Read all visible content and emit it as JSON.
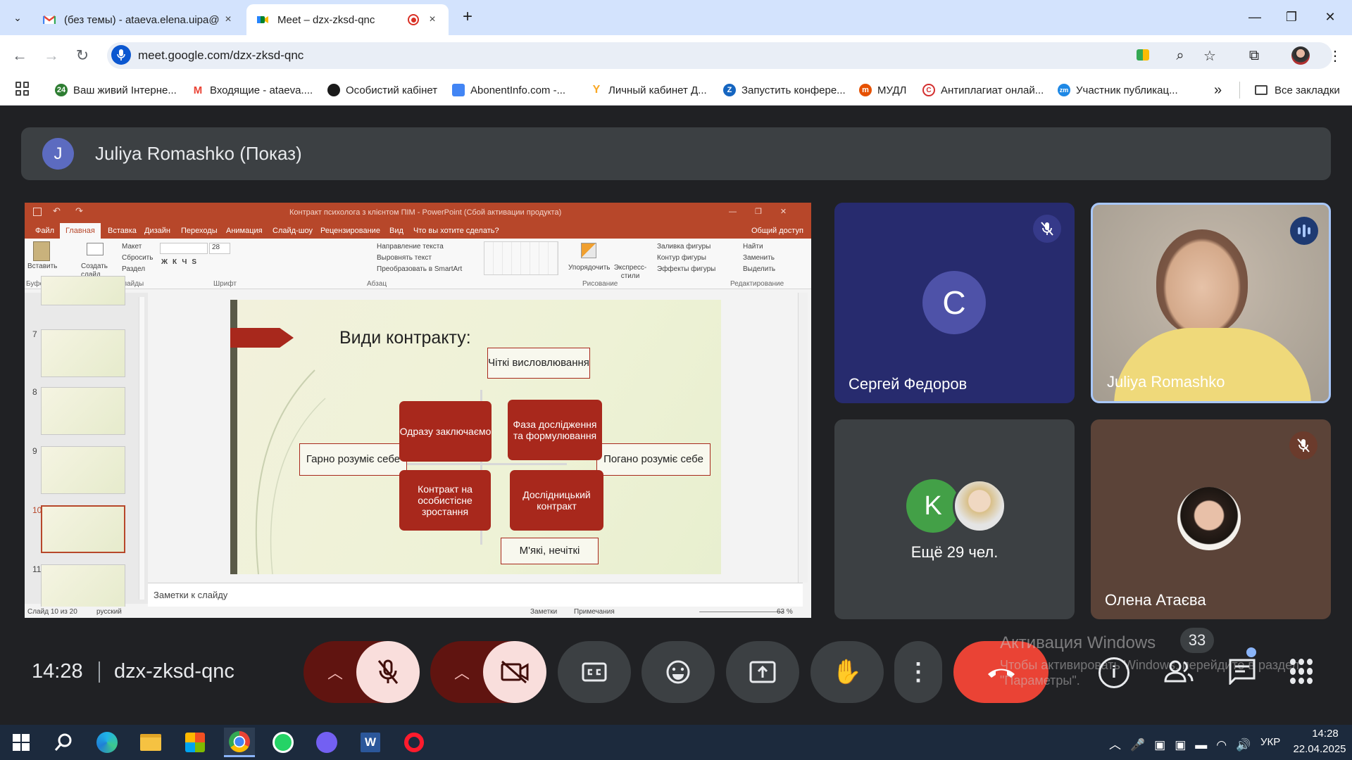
{
  "browser": {
    "tabs": [
      {
        "title": "(без темы) - ataeva.elena.uipa@",
        "close": "×"
      },
      {
        "title": "Meet – dzx-zksd-qnc",
        "close": "×"
      }
    ],
    "new_tab": "+",
    "url": "meet.google.com/dzx-zksd-qnc",
    "bookmarks": [
      {
        "label": "Ваш живий Інтерне...",
        "icon": "24",
        "color": "#2e7d32"
      },
      {
        "label": "Входящие - ataeva....",
        "icon": "M",
        "color": "#ea4335"
      },
      {
        "label": "Особистий кабінет",
        "icon": "",
        "color": "#1a1a1a"
      },
      {
        "label": "AbonentInfo.com -...",
        "icon": "",
        "color": "#4285f4"
      },
      {
        "label": "Личный кабинет Д...",
        "icon": "Y",
        "color": "#f9a825"
      },
      {
        "label": "Запустить конфере...",
        "icon": "Z",
        "color": "#1565c0"
      },
      {
        "label": "МУДЛ",
        "icon": "m",
        "color": "#e65100"
      },
      {
        "label": "Антиплагиат онлай...",
        "icon": "C",
        "color": "#d32f2f"
      },
      {
        "label": "Участник публикац...",
        "icon": "zm",
        "color": "#1e88e5"
      }
    ],
    "all_bookmarks": "Все закладки",
    "more": "»"
  },
  "meet": {
    "presenter_initial": "J",
    "presenter_label": "Juliya Romashko (Показ)",
    "participants": [
      {
        "name": "Сергей Федоров",
        "initial": "C",
        "muted": true
      },
      {
        "name": "Juliya Romashko",
        "speaking": true
      },
      {
        "more_label": "Ещё 29 чел.",
        "initial": "K"
      },
      {
        "name": "Олена Атаєва",
        "muted": true
      }
    ],
    "time": "14:28",
    "meeting_code": "dzx-zksd-qnc",
    "people_count": "33",
    "activation_title": "Активация Windows",
    "activation_body": "Чтобы активировать Windows, перейдите в раздел \"Параметры\"."
  },
  "ppt": {
    "title": "Контракт психолога з клієнтом ПІМ - PowerPoint (Сбой активации продукта)",
    "tabs": [
      "Файл",
      "Главная",
      "Вставка",
      "Дизайн",
      "Переходы",
      "Анимация",
      "Слайд-шоу",
      "Рецензирование",
      "Вид",
      "Что вы хотите сделать?"
    ],
    "share": "Общий доступ",
    "ribbon_groups": [
      "Буфер обмена",
      "Слайды",
      "Шрифт",
      "Абзац",
      "Рисование",
      "Редактирование"
    ],
    "ribbon_items": {
      "paste": "Вставить",
      "new_slide": "Создать слайд",
      "layout": "Макет",
      "reset": "Сбросить",
      "section": "Раздел",
      "font_size": "28",
      "text_direction": "Направление текста",
      "align_text": "Выровнять текст",
      "smartart": "Преобразовать в SmartArt",
      "arrange": "Упорядочить",
      "quick_styles": "Экспресс-стили",
      "fill": "Заливка фигуры",
      "outline": "Контур фигуры",
      "effects": "Эффекты фигуры",
      "find": "Найти",
      "replace": "Заменить",
      "select": "Выделить"
    },
    "thumb_numbers": [
      "7",
      "8",
      "9",
      "10",
      "11"
    ],
    "slide": {
      "title": "Види контракту:",
      "top": "Чіткі висловлювання",
      "bottom": "М'які, нечіткі",
      "left": "Гарно розуміє себе",
      "right": "Погано розуміє себе",
      "q1": "Одразу заключаємо",
      "q2": "Фаза дослідження та формулювання",
      "q3": "Контракт на особистісне зростання",
      "q4": "Дослідницький контракт"
    },
    "notes": "Заметки к слайду",
    "status_left": "Слайд 10 из 20",
    "language": "русский",
    "notes_btn": "Заметки",
    "comments_btn": "Примечания",
    "zoom": "63 %"
  },
  "taskbar": {
    "lang": "УКР",
    "time": "14:28",
    "date": "22.04.2025"
  },
  "colors": {
    "accent_red": "#a8281c",
    "end_call": "#ea4335",
    "muted_btn": "#f9dedc"
  }
}
